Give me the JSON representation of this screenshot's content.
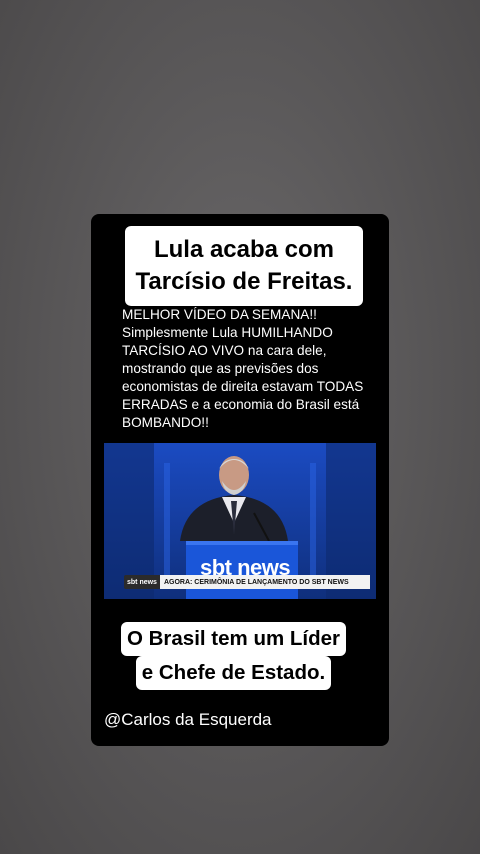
{
  "story": {
    "title_line1": "Lula acaba com",
    "title_line2": "Tarcísio de Freitas.",
    "body": "MELHOR VÍDEO DA SEMANA!!\nSimplesmente Lula HUMILHANDO TARCÍSIO AO VIVO na cara dele, mostrando que as previsões dos economistas de direita estavam TODAS ERRADAS e a economia do Brasil está BOMBANDO!!",
    "video": {
      "podium_logo": "sbt news",
      "lower_third_logo": "sbt news",
      "lower_third_text": "AGORA: CERIMÔNIA DE LANÇAMENTO DO SBT NEWS"
    },
    "caption_line1": "O Brasil tem um Líder",
    "caption_line2": "e Chefe de Estado.",
    "handle": "@Carlos da Esquerda"
  },
  "colors": {
    "background": "#5b595a",
    "card": "#000000",
    "stage_blue": "#163c9a"
  }
}
